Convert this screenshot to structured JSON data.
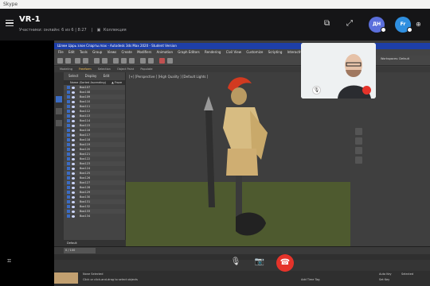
{
  "app": {
    "title": "Skype"
  },
  "call": {
    "name": "VR-1",
    "info": "Участники: онлайн: 6 из 6 | 8:27",
    "gallery_label": "Коллекция"
  },
  "participants": [
    {
      "initials": "ДН",
      "color": "#5b6fdc"
    },
    {
      "initials": "Fr",
      "color": "#2f8fe0"
    }
  ],
  "max": {
    "title": "Шлем Царь злое Спарты.max - Autodesk 3ds Max 2020 - Student Version",
    "menu": [
      "File",
      "Edit",
      "Tools",
      "Group",
      "Views",
      "Create",
      "Modifiers",
      "Animation",
      "Graph Editors",
      "Rendering",
      "Civil View",
      "Customize",
      "Scripting",
      "Interactive",
      "Content",
      "Arnold",
      "Help"
    ],
    "workspace": "Workspaces: Default",
    "ribbon_tabs": [
      "Modeling",
      "Freeform",
      "Selection",
      "Object Paint",
      "Populate"
    ],
    "active_ribbon": "Freeform",
    "scene_tabs": [
      "Select",
      "Display",
      "Edit"
    ],
    "scene_header": "Name (Sorted Ascending)",
    "frozen": "▲ Froze",
    "objects": [
      "Box107",
      "Box108",
      "Box109",
      "Box110",
      "Box111",
      "Box112",
      "Box113",
      "Box114",
      "Box115",
      "Box116",
      "Box117",
      "Box118",
      "Box119",
      "Box120",
      "Box121",
      "Box122",
      "Box123",
      "Box124",
      "Box125",
      "Box126",
      "Box127",
      "Box128",
      "Box129",
      "Box130",
      "Box131",
      "Box132",
      "Box133",
      "Box134"
    ],
    "layer": "Default",
    "viewport_label": "[+] [Perspective ] [High Quality ] [Default Lights ]",
    "timeline": "0 / 100",
    "status": "None Selected",
    "hint": "Click or click-and-drag to select objects",
    "add_time_tag": "Add Time Tag",
    "set_key": "Set Key",
    "selected": "Selected",
    "autokey": "Auto Key"
  },
  "colors": {
    "accent": "#5b6fdc",
    "hangup": "#e5332a",
    "max_title": "#1e3fa8"
  }
}
